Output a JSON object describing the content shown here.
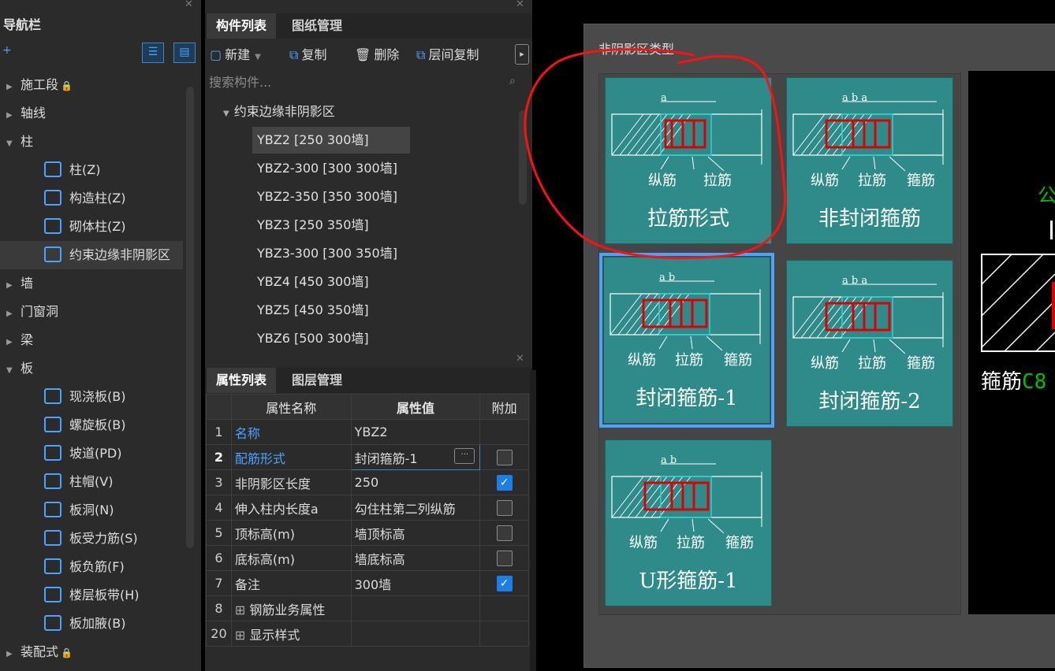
{
  "nav": {
    "title": "导航栏",
    "items": [
      {
        "label": "施工段",
        "type": "group",
        "lock": true
      },
      {
        "label": "轴线",
        "type": "group"
      },
      {
        "label": "柱",
        "type": "group",
        "open": true
      },
      {
        "label": "柱(Z)",
        "type": "child"
      },
      {
        "label": "构造柱(Z)",
        "type": "child"
      },
      {
        "label": "砌体柱(Z)",
        "type": "child"
      },
      {
        "label": "约束边缘非阴影区",
        "type": "child",
        "selected": true
      },
      {
        "label": "墙",
        "type": "group"
      },
      {
        "label": "门窗洞",
        "type": "group"
      },
      {
        "label": "梁",
        "type": "group"
      },
      {
        "label": "板",
        "type": "group",
        "open": true
      },
      {
        "label": "现浇板(B)",
        "type": "child"
      },
      {
        "label": "螺旋板(B)",
        "type": "child"
      },
      {
        "label": "坡道(PD)",
        "type": "child"
      },
      {
        "label": "柱帽(V)",
        "type": "child"
      },
      {
        "label": "板洞(N)",
        "type": "child"
      },
      {
        "label": "板受力筋(S)",
        "type": "child"
      },
      {
        "label": "板负筋(F)",
        "type": "child"
      },
      {
        "label": "楼层板带(H)",
        "type": "child"
      },
      {
        "label": "板加腋(B)",
        "type": "child"
      },
      {
        "label": "装配式",
        "type": "group",
        "lock": true
      }
    ]
  },
  "components": {
    "tabs": [
      "构件列表",
      "图纸管理"
    ],
    "toolbar": {
      "new": "新建",
      "copy": "复制",
      "delete": "删除",
      "floor_copy": "层间复制"
    },
    "search_placeholder": "搜索构件...",
    "group": "约束边缘非阴影区",
    "items": [
      "YBZ2 [250 300墙]",
      "YBZ2-300 [300 300墙]",
      "YBZ2-350 [350 300墙]",
      "YBZ3 [250 350墙]",
      "YBZ3-300 [300 350墙]",
      "YBZ4 [450 300墙]",
      "YBZ5 [450 350墙]",
      "YBZ6 [500 300墙]"
    ]
  },
  "properties": {
    "tabs": [
      "属性列表",
      "图层管理"
    ],
    "headers": [
      "属性名称",
      "属性值",
      "附加"
    ],
    "rows": [
      {
        "idx": "1",
        "name": "名称",
        "value": "YBZ2",
        "blue": true,
        "check": null
      },
      {
        "idx": "2",
        "name": "配筋形式",
        "value": "封闭箍筋-1",
        "blue": true,
        "check": false,
        "editing": true
      },
      {
        "idx": "3",
        "name": "非阴影区长度",
        "value": "250",
        "check": true
      },
      {
        "idx": "4",
        "name": "伸入柱内长度a",
        "value": "勾住柱第二列纵筋",
        "check": false
      },
      {
        "idx": "5",
        "name": "顶标高(m)",
        "value": "墙顶标高",
        "check": false
      },
      {
        "idx": "6",
        "name": "底标高(m)",
        "value": "墙底标高",
        "check": false
      },
      {
        "idx": "7",
        "name": "备注",
        "value": "300墙",
        "check": true
      },
      {
        "idx": "8",
        "name": "钢筋业务属性",
        "value": "",
        "expand": true,
        "check": null
      },
      {
        "idx": "20",
        "name": "显示样式",
        "value": "",
        "expand": true,
        "check": null
      }
    ]
  },
  "dialog": {
    "group_title": "非阴影区类型",
    "cards": [
      {
        "label": "拉筋形式",
        "dims": "a",
        "subs": [
          "纵筋",
          "拉筋"
        ]
      },
      {
        "label": "非封闭箍筋",
        "dims": "a  b  a",
        "subs": [
          "纵筋",
          "拉筋",
          "箍筋"
        ]
      },
      {
        "label": "封闭箍筋-1",
        "dims": "a  b",
        "subs": [
          "纵筋",
          "拉筋",
          "箍筋"
        ],
        "selected": true
      },
      {
        "label": "封闭箍筋-2",
        "dims": "a  b  a",
        "subs": [
          "纵筋",
          "拉筋",
          "箍筋"
        ]
      },
      {
        "label": "U形箍筋-1",
        "dims": "a  b",
        "subs": [
          "纵筋",
          "拉筋",
          "箍筋"
        ]
      }
    ],
    "preview": {
      "top_char": "公",
      "stirrup_label": "箍筋",
      "stirrup_value": "C8"
    }
  },
  "colors": {
    "accent": "#4aa3ff",
    "card": "#2f8a8a",
    "rebar": "#e00000",
    "annotation": "#ff0000",
    "green_text": "#00c000"
  }
}
